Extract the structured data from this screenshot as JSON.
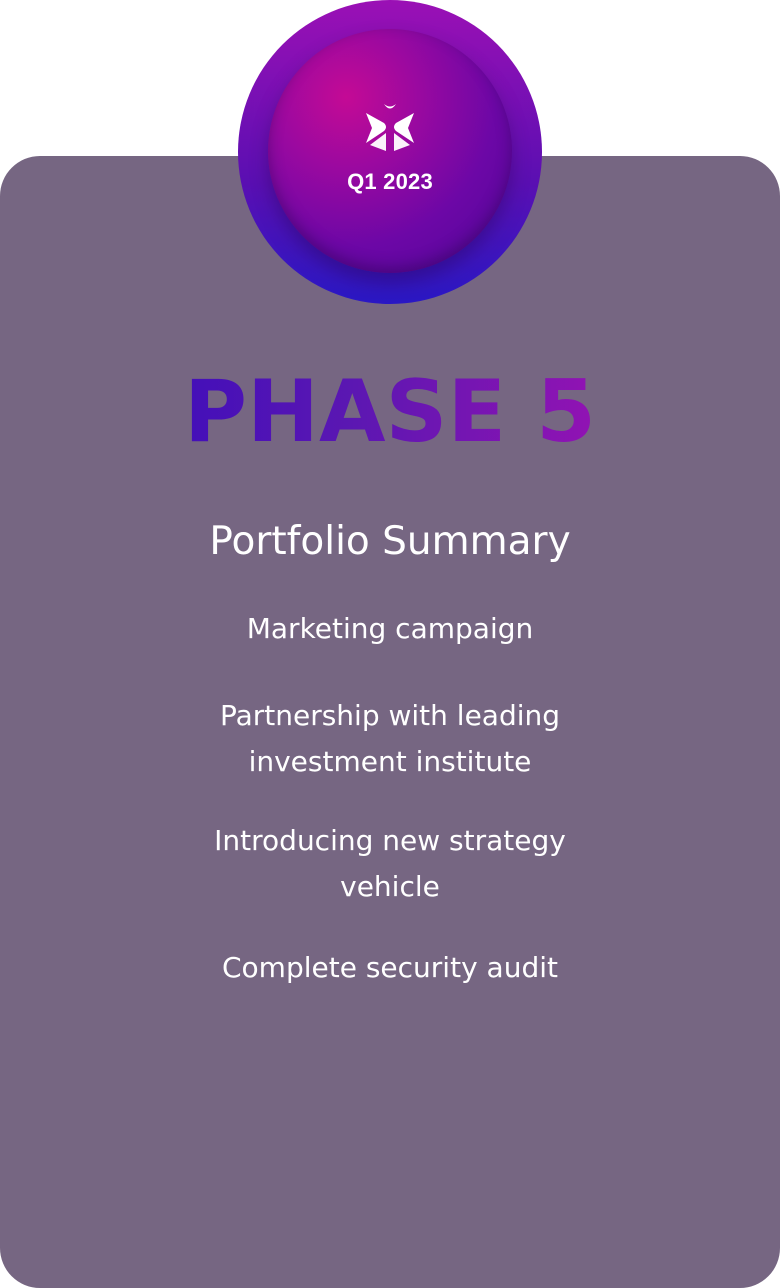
{
  "badge": {
    "date": "Q1 2023",
    "logo_icon": "butterfly-logo-icon"
  },
  "phase": {
    "title": "PHASE 5"
  },
  "section": {
    "heading": "Portfolio Summary",
    "items": [
      "Marketing campaign",
      "Partnership with leading investment institute",
      "Introducing new strategy vehicle",
      "Complete security audit"
    ]
  },
  "colors": {
    "card_bg": "#766682",
    "badge_gradient_start": "#c40a95",
    "badge_gradient_end": "#50089a",
    "phase_gradient_start": "#2a06c0",
    "phase_gradient_end": "#b20fb0",
    "text": "#ffffff"
  }
}
